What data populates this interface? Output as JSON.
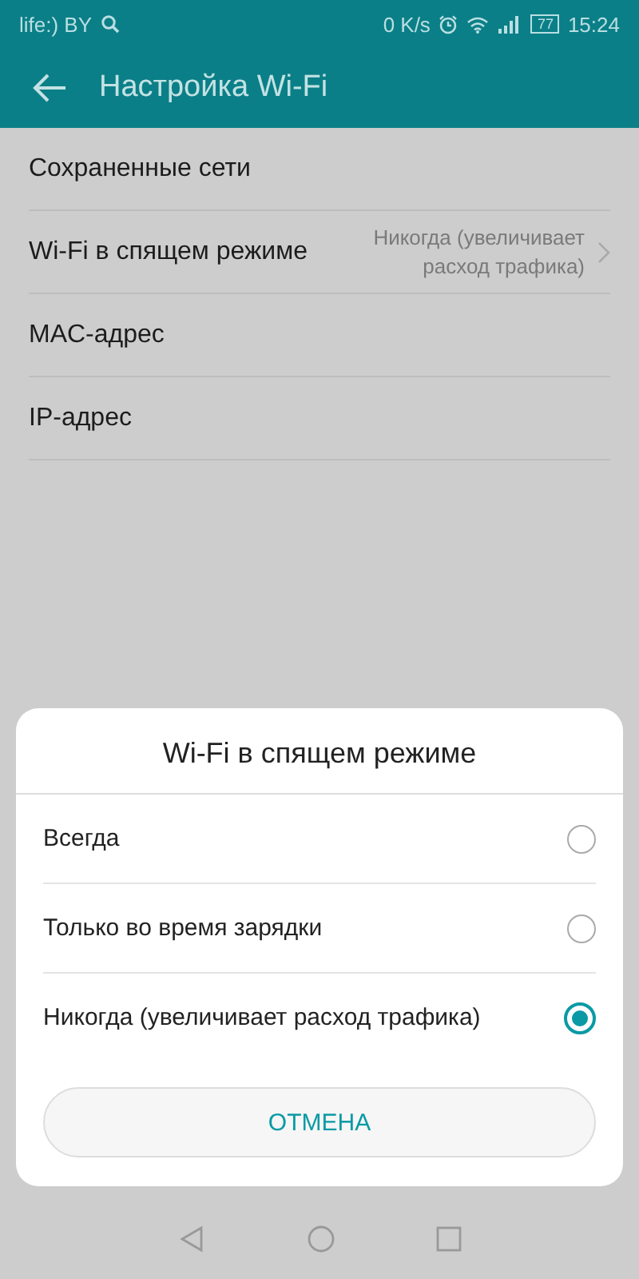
{
  "status_bar": {
    "carrier": "life:) BY",
    "speed": "0 K/s",
    "battery": "77",
    "time": "15:24"
  },
  "header": {
    "title": "Настройка Wi-Fi"
  },
  "settings": [
    {
      "label": "Сохраненные сети"
    },
    {
      "label": "Wi-Fi в спящем режиме",
      "value": "Никогда (увеличивает расход трафика)"
    },
    {
      "label": "MAC-адрес"
    },
    {
      "label": "IP-адрес"
    }
  ],
  "dialog": {
    "title": "Wi-Fi в спящем режиме",
    "options": [
      {
        "label": "Всегда",
        "selected": false
      },
      {
        "label": "Только во время зарядки",
        "selected": false
      },
      {
        "label": "Никогда (увеличивает расход трафика)",
        "selected": true
      }
    ],
    "cancel": "ОТМЕНА"
  }
}
